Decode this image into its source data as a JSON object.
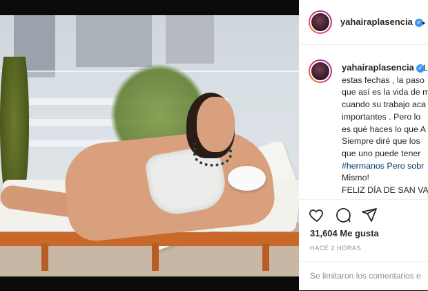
{
  "post": {
    "username": "yahairaplasencia",
    "caption_lines": [
      "L",
      "estas fechas , la paso",
      "que así es la vida de m",
      "cuando su trabajo aca",
      "importantes . Pero lo",
      "es qué haces lo que A",
      "Siempre diré que los",
      "que uno puede tener",
      "#hermanos Pero sobr",
      "Mismo!",
      "FELIZ DÍA DE SAN VA"
    ],
    "likes": "31,604 Me gusta",
    "timestamp": "HACE 2 HORAS",
    "comments_notice": "Se limitaron los comentarios e"
  },
  "icons": {
    "heart": "heart-icon",
    "comment": "comment-icon",
    "share": "share-icon",
    "verified": "verified-badge-icon"
  },
  "colors": {
    "verified": "#3897f0",
    "hashtag": "#00376b"
  }
}
